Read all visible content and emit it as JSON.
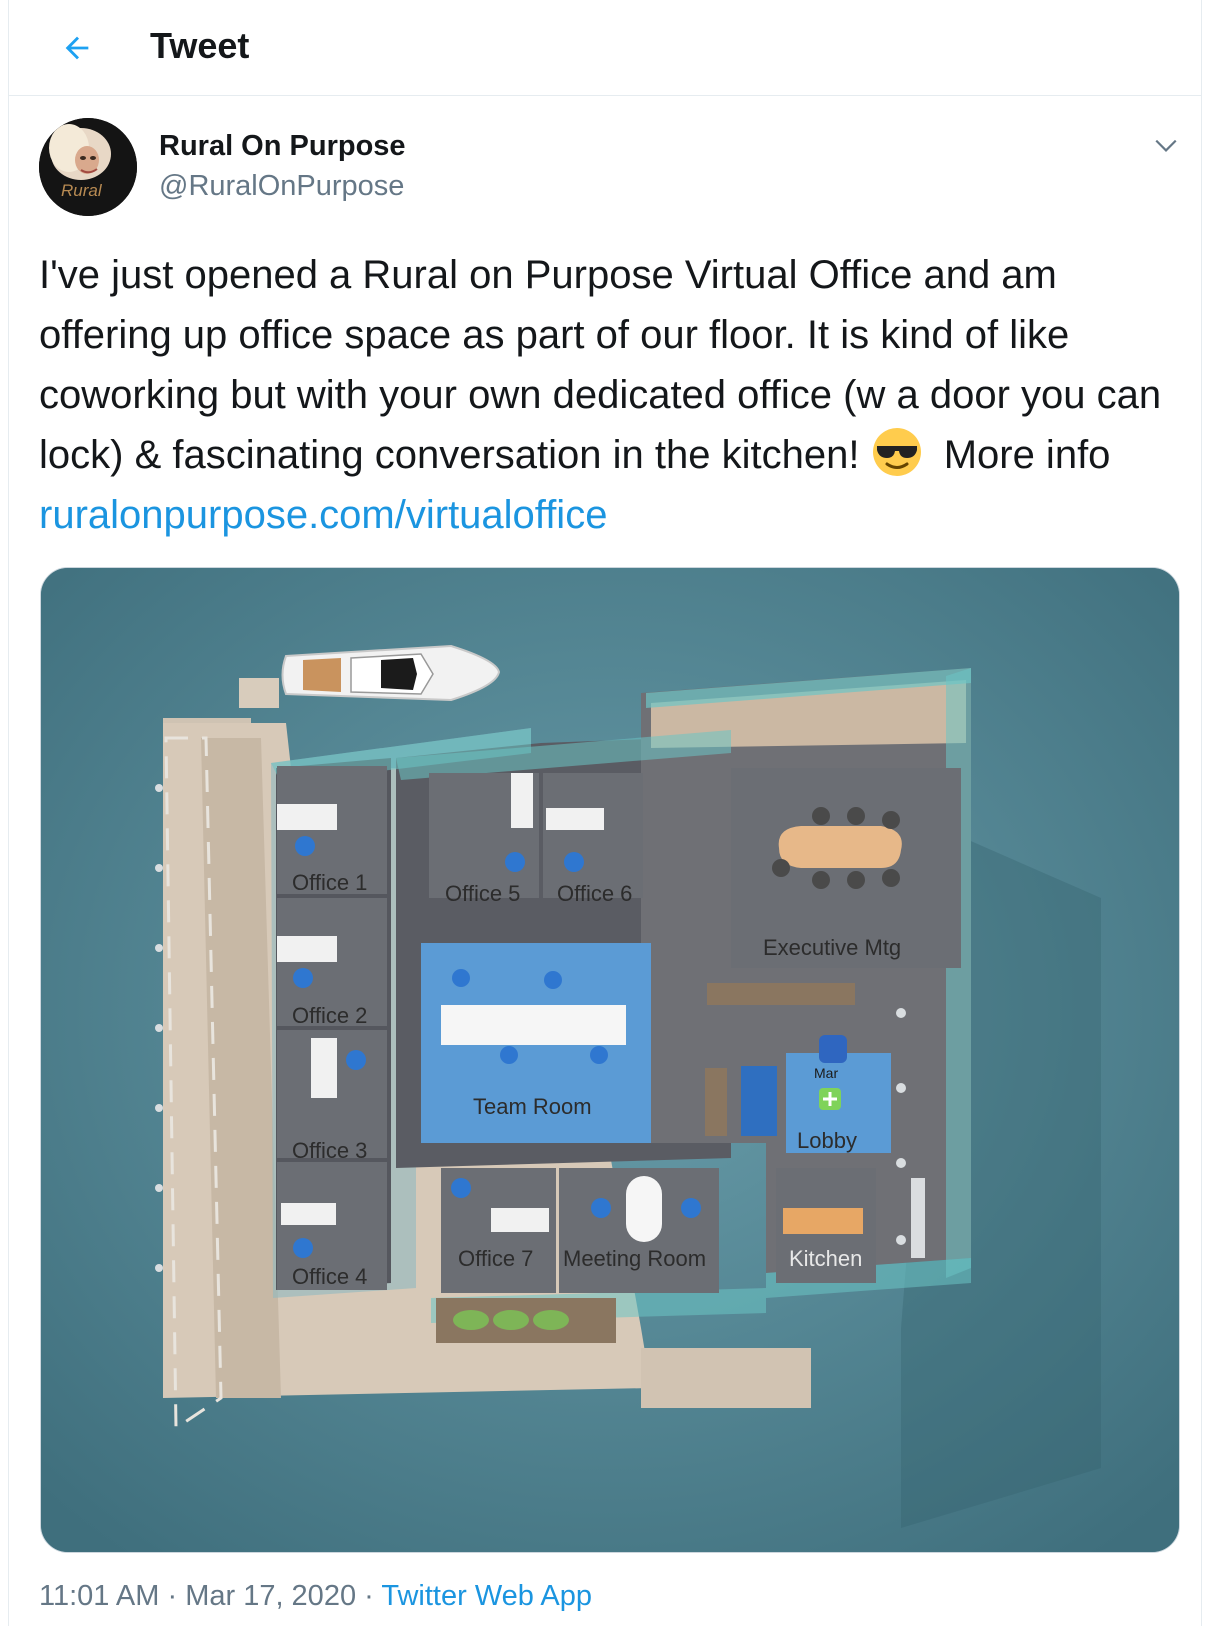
{
  "header": {
    "title": "Tweet"
  },
  "tweet": {
    "display_name": "Rural On Purpose",
    "handle": "@RuralOnPurpose",
    "avatar_logo_text": "Rural",
    "text_main": "I've just opened a Rural on Purpose Virtual Office and am offering up office space as part of our floor. It is kind of like coworking but with your own dedicated office (w a door you can lock) & fascinating conversation in the kitchen!",
    "text_more": "More info",
    "link": "ruralonpurpose.com/virtualoffice",
    "time": "11:01 AM",
    "separator": "·",
    "date": "Mar 17, 2020",
    "source_app": "Twitter Web App"
  },
  "floorplan": {
    "rooms": {
      "office1": "Office 1",
      "office2": "Office 2",
      "office3": "Office 3",
      "office4": "Office 4",
      "office5": "Office 5",
      "office6": "Office 6",
      "office7": "Office 7",
      "team_room": "Team Room",
      "meeting_room": "Meeting Room",
      "executive_mtg": "Executive Mtg",
      "lobby": "Lobby",
      "kitchen": "Kitchen"
    },
    "avatar_label": "Mar"
  },
  "colors": {
    "link": "#1b95e0",
    "secondary_text": "#657786",
    "water": "#4c7f8d",
    "team_room": "#5b9bd5",
    "glass": "#6cc4c4"
  },
  "icons": {
    "back": "arrow-left-icon",
    "more": "chevron-down-icon",
    "emoji": "sunglasses-emoji"
  }
}
